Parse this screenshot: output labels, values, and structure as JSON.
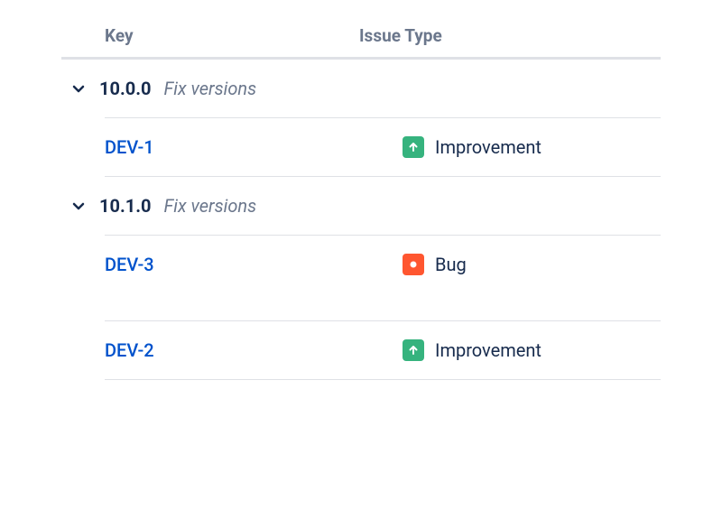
{
  "headers": {
    "key": "Key",
    "type": "Issue Type"
  },
  "groups": [
    {
      "version": "10.0.0",
      "label": "Fix versions",
      "issues": [
        {
          "key": "DEV-1",
          "type": "Improvement",
          "icon": "improvement"
        }
      ]
    },
    {
      "version": "10.1.0",
      "label": "Fix versions",
      "issues": [
        {
          "key": "DEV-3",
          "type": "Bug",
          "icon": "bug"
        },
        {
          "key": "DEV-2",
          "type": "Improvement",
          "icon": "improvement"
        }
      ]
    }
  ]
}
